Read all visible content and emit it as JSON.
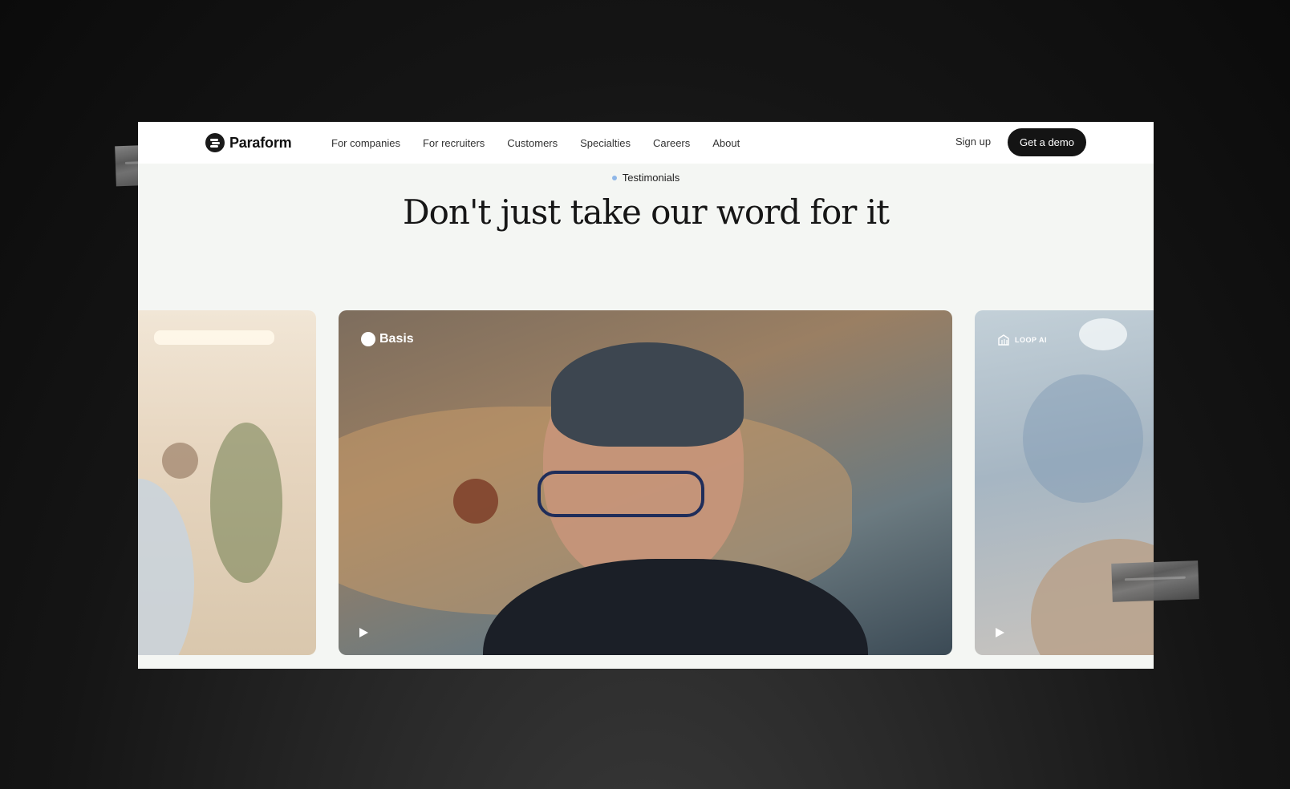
{
  "nav": {
    "brand": "Paraform",
    "links": [
      "For companies",
      "For recruiters",
      "Customers",
      "Specialties",
      "Careers",
      "About"
    ],
    "signup_label": "Sign up",
    "cta_label": "Get a demo"
  },
  "section": {
    "eyebrow": "Testimonials",
    "title": "Don't just take our word for it"
  },
  "cards": [
    {
      "company": "",
      "playable": false
    },
    {
      "company": "Basis",
      "playable": true
    },
    {
      "company": "LOOP AI",
      "playable": true
    }
  ],
  "colors": {
    "accent_dot": "#8fb7e8",
    "cta_bg": "#141414",
    "section_bg": "#f4f6f3"
  },
  "icons": [
    "paraform-logo-icon",
    "basis-logo-icon",
    "loop-ai-logo-icon",
    "play-icon"
  ]
}
